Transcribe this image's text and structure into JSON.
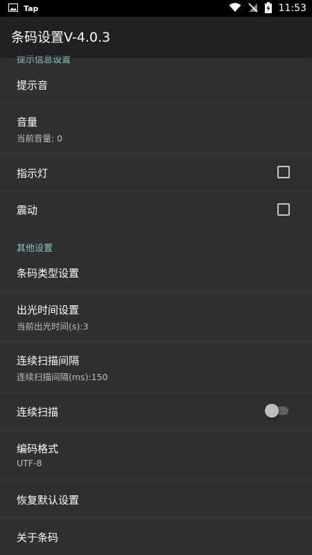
{
  "status_bar": {
    "app_label": "Tap",
    "time": "11:53",
    "icons": [
      "image-icon",
      "wifi-icon",
      "no-sim-icon",
      "battery-charging-icon"
    ]
  },
  "toolbar": {
    "title": "条码设置V-4.0.3"
  },
  "categories": {
    "prompt": "提示信息设置",
    "other": "其他设置"
  },
  "prefs": {
    "prompt_tone": {
      "title": "提示音"
    },
    "volume": {
      "title": "音量",
      "summary": "当前音量: 0"
    },
    "indicator_light": {
      "title": "指示灯",
      "checked": false
    },
    "vibration": {
      "title": "震动",
      "checked": false
    },
    "barcode_type": {
      "title": "条码类型设置"
    },
    "light_time": {
      "title": "出光时间设置",
      "summary": "当前出光时间(s):3"
    },
    "scan_interval": {
      "title": "连续扫描间隔",
      "summary": "连续扫描间隔(ms):150"
    },
    "continuous_scan": {
      "title": "连续扫描",
      "enabled": false
    },
    "encoding": {
      "title": "编码格式",
      "summary": "UTF-8"
    },
    "restore_default": {
      "title": "恢复默认设置"
    },
    "about": {
      "title": "关于条码"
    }
  },
  "colors": {
    "accent": "#80cbc4",
    "background": "#303030",
    "toolbar": "#212121"
  }
}
